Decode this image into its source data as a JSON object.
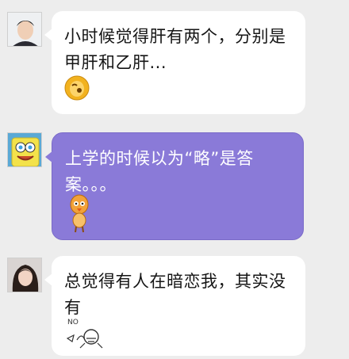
{
  "messages": [
    {
      "text": "小时候觉得肝有两个，分别是甲肝和乙肝..."
    },
    {
      "text": "上学的时候以为“略”是答案。。。"
    },
    {
      "text": "总觉得有人在暗恋我，其实没有"
    }
  ],
  "stickers": {
    "third": {
      "label": "NO"
    }
  },
  "colors": {
    "background": "#ededed",
    "bubble_white": "#ffffff",
    "bubble_purple": "#8a7ad8"
  }
}
